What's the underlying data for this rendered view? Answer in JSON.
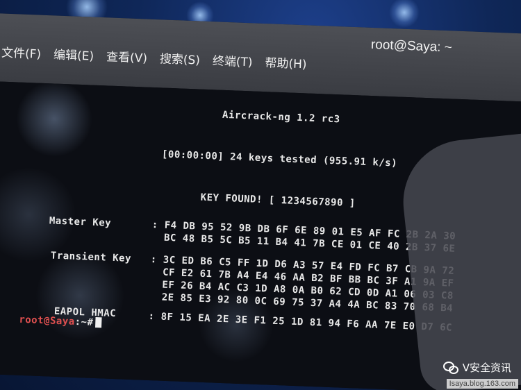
{
  "window": {
    "title": "root@Saya: ~"
  },
  "menu": {
    "items": [
      "文件(F)",
      "编辑(E)",
      "查看(V)",
      "搜索(S)",
      "终端(T)",
      "帮助(H)"
    ]
  },
  "terminal": {
    "banner": "Aircrack-ng 1.2 rc3",
    "progress": "[00:00:00] 24 keys tested (955.91 k/s)",
    "key_found": "KEY FOUND! [ 1234567890 ]",
    "master_key": {
      "label": "Master Key",
      "lines": [
        "F4 DB 95 52 9B DB 6F 6E 89 01 E5 AF FC 2B 2A 30",
        "BC 48 B5 5C B5 11 B4 41 7B CE 01 CE 40 2B 37 6E"
      ]
    },
    "transient_key": {
      "label": "Transient Key",
      "lines": [
        "3C ED B6 C5 FF 1D D6 A3 57 E4 FD FC B7 CB 9A 72",
        "CF E2 61 7B A4 E4 46 AA B2 BF BB BC 3F A1 9A EF",
        "EF 26 B4 AC C3 1D A8 0A B0 62 CD 0D A1 06 03 C8",
        "2E 85 E3 92 80 0C 69 75 37 A4 4A BC 83 70 68 B4"
      ]
    },
    "eapol_hmac": {
      "label": "EAPOL HMAC",
      "lines": [
        "8F 15 EA 2E 3E F1 25 1D 81 94 F6 AA 7E E0 D7 6C"
      ]
    },
    "prompt_user": "root@Saya",
    "prompt_rest": ":~#"
  },
  "watermark": {
    "text": "V安全资讯",
    "icon": "wechat-icon",
    "url": "Isaya.blog.163.com"
  }
}
